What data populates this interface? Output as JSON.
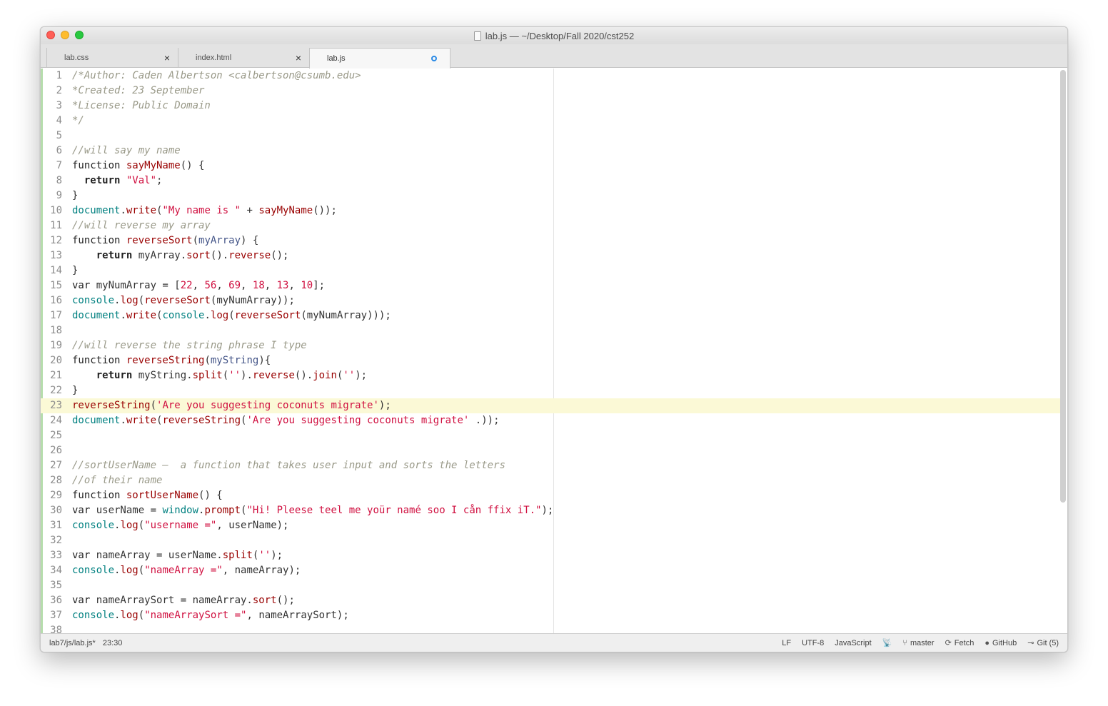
{
  "window": {
    "title": "lab.js — ~/Desktop/Fall 2020/cst252"
  },
  "tabs": [
    {
      "label": "lab.css",
      "close": "×"
    },
    {
      "label": "index.html",
      "close": "×"
    },
    {
      "label": "lab.js",
      "modified": true
    }
  ],
  "editor": {
    "current_line": 23,
    "lines": [
      {
        "n": "1",
        "tokens": [
          [
            "c",
            "/*Author: Caden Albertson <calbertson@csumb.edu>"
          ]
        ]
      },
      {
        "n": "2",
        "tokens": [
          [
            "c",
            "*Created: 23 September"
          ]
        ]
      },
      {
        "n": "3",
        "tokens": [
          [
            "c",
            "*License: Public Domain"
          ]
        ]
      },
      {
        "n": "4",
        "tokens": [
          [
            "c",
            "*/"
          ]
        ]
      },
      {
        "n": "5",
        "tokens": []
      },
      {
        "n": "6",
        "tokens": [
          [
            "c",
            "//will say my name"
          ]
        ]
      },
      {
        "n": "7",
        "tokens": [
          [
            "k",
            "function "
          ],
          [
            "f",
            "sayMyName"
          ],
          [
            "t",
            "() {"
          ]
        ]
      },
      {
        "n": "8",
        "tokens": [
          [
            "t",
            "  "
          ],
          [
            "kb",
            "return "
          ],
          [
            "s",
            "\"Val\""
          ],
          [
            "t",
            ";"
          ]
        ]
      },
      {
        "n": "9",
        "tokens": [
          [
            "t",
            "}"
          ]
        ]
      },
      {
        "n": "10",
        "tokens": [
          [
            "o",
            "document"
          ],
          [
            "t",
            "."
          ],
          [
            "f",
            "write"
          ],
          [
            "t",
            "("
          ],
          [
            "s",
            "\"My name is \""
          ],
          [
            "t",
            " + "
          ],
          [
            "f",
            "sayMyName"
          ],
          [
            "t",
            "());"
          ]
        ]
      },
      {
        "n": "11",
        "tokens": [
          [
            "c",
            "//will reverse my array"
          ]
        ]
      },
      {
        "n": "12",
        "tokens": [
          [
            "k",
            "function "
          ],
          [
            "f",
            "reverseSort"
          ],
          [
            "t",
            "("
          ],
          [
            "p",
            "myArray"
          ],
          [
            "t",
            ") {"
          ]
        ]
      },
      {
        "n": "13",
        "tokens": [
          [
            "t",
            "    "
          ],
          [
            "kb",
            "return "
          ],
          [
            "t",
            "myArray."
          ],
          [
            "f",
            "sort"
          ],
          [
            "t",
            "()."
          ],
          [
            "f",
            "reverse"
          ],
          [
            "t",
            "();"
          ]
        ]
      },
      {
        "n": "14",
        "tokens": [
          [
            "t",
            "}"
          ]
        ]
      },
      {
        "n": "15",
        "tokens": [
          [
            "k",
            "var "
          ],
          [
            "t",
            "myNumArray = ["
          ],
          [
            "n",
            "22"
          ],
          [
            "t",
            ", "
          ],
          [
            "n",
            "56"
          ],
          [
            "t",
            ", "
          ],
          [
            "n",
            "69"
          ],
          [
            "t",
            ", "
          ],
          [
            "n",
            "18"
          ],
          [
            "t",
            ", "
          ],
          [
            "n",
            "13"
          ],
          [
            "t",
            ", "
          ],
          [
            "n",
            "10"
          ],
          [
            "t",
            "];"
          ]
        ]
      },
      {
        "n": "16",
        "tokens": [
          [
            "o",
            "console"
          ],
          [
            "t",
            "."
          ],
          [
            "f",
            "log"
          ],
          [
            "t",
            "("
          ],
          [
            "f",
            "reverseSort"
          ],
          [
            "t",
            "(myNumArray));"
          ]
        ]
      },
      {
        "n": "17",
        "tokens": [
          [
            "o",
            "document"
          ],
          [
            "t",
            "."
          ],
          [
            "f",
            "write"
          ],
          [
            "t",
            "("
          ],
          [
            "o",
            "console"
          ],
          [
            "t",
            "."
          ],
          [
            "f",
            "log"
          ],
          [
            "t",
            "("
          ],
          [
            "f",
            "reverseSort"
          ],
          [
            "t",
            "(myNumArray)));"
          ]
        ]
      },
      {
        "n": "18",
        "tokens": []
      },
      {
        "n": "19",
        "tokens": [
          [
            "c",
            "//will reverse the string phrase I type"
          ]
        ]
      },
      {
        "n": "20",
        "tokens": [
          [
            "k",
            "function "
          ],
          [
            "f",
            "reverseString"
          ],
          [
            "t",
            "("
          ],
          [
            "p",
            "myString"
          ],
          [
            "t",
            "){"
          ]
        ]
      },
      {
        "n": "21",
        "tokens": [
          [
            "t",
            "    "
          ],
          [
            "kb",
            "return "
          ],
          [
            "t",
            "myString."
          ],
          [
            "f",
            "split"
          ],
          [
            "t",
            "("
          ],
          [
            "s",
            "''"
          ],
          [
            "t",
            ")."
          ],
          [
            "f",
            "reverse"
          ],
          [
            "t",
            "()."
          ],
          [
            "f",
            "join"
          ],
          [
            "t",
            "("
          ],
          [
            "s",
            "''"
          ],
          [
            "t",
            ");"
          ]
        ]
      },
      {
        "n": "22",
        "tokens": [
          [
            "t",
            "}"
          ]
        ]
      },
      {
        "n": "23",
        "tokens": [
          [
            "f",
            "reverseString"
          ],
          [
            "t",
            "("
          ],
          [
            "s",
            "'Are you suggesting coconuts migrate'"
          ],
          [
            "t",
            ");"
          ]
        ]
      },
      {
        "n": "24",
        "tokens": [
          [
            "o",
            "document"
          ],
          [
            "t",
            "."
          ],
          [
            "f",
            "write"
          ],
          [
            "t",
            "("
          ],
          [
            "f",
            "reverseString"
          ],
          [
            "t",
            "("
          ],
          [
            "s",
            "'Are you suggesting coconuts migrate'"
          ],
          [
            "t",
            " .));"
          ]
        ]
      },
      {
        "n": "25",
        "tokens": []
      },
      {
        "n": "26",
        "tokens": []
      },
      {
        "n": "27",
        "tokens": [
          [
            "c",
            "//sortUserName –  a function that takes user input and sorts the letters"
          ]
        ]
      },
      {
        "n": "28",
        "tokens": [
          [
            "c",
            "//of their name"
          ]
        ]
      },
      {
        "n": "29",
        "tokens": [
          [
            "k",
            "function "
          ],
          [
            "f",
            "sortUserName"
          ],
          [
            "t",
            "() {"
          ]
        ]
      },
      {
        "n": "30",
        "tokens": [
          [
            "k",
            "var "
          ],
          [
            "t",
            "userName = "
          ],
          [
            "o",
            "window"
          ],
          [
            "t",
            "."
          ],
          [
            "f",
            "prompt"
          ],
          [
            "t",
            "("
          ],
          [
            "s",
            "\"Hi! Pleese teel me yoür namé soo I cån ffix iT.\""
          ],
          [
            "t",
            ");"
          ]
        ]
      },
      {
        "n": "31",
        "tokens": [
          [
            "o",
            "console"
          ],
          [
            "t",
            "."
          ],
          [
            "f",
            "log"
          ],
          [
            "t",
            "("
          ],
          [
            "s",
            "\"username =\""
          ],
          [
            "t",
            ", userName);"
          ]
        ]
      },
      {
        "n": "32",
        "tokens": []
      },
      {
        "n": "33",
        "tokens": [
          [
            "k",
            "var "
          ],
          [
            "t",
            "nameArray = userName."
          ],
          [
            "f",
            "split"
          ],
          [
            "t",
            "("
          ],
          [
            "s",
            "''"
          ],
          [
            "t",
            ");"
          ]
        ]
      },
      {
        "n": "34",
        "tokens": [
          [
            "o",
            "console"
          ],
          [
            "t",
            "."
          ],
          [
            "f",
            "log"
          ],
          [
            "t",
            "("
          ],
          [
            "s",
            "\"nameArray =\""
          ],
          [
            "t",
            ", nameArray);"
          ]
        ]
      },
      {
        "n": "35",
        "tokens": []
      },
      {
        "n": "36",
        "tokens": [
          [
            "k",
            "var "
          ],
          [
            "t",
            "nameArraySort = nameArray."
          ],
          [
            "f",
            "sort"
          ],
          [
            "t",
            "();"
          ]
        ]
      },
      {
        "n": "37",
        "tokens": [
          [
            "o",
            "console"
          ],
          [
            "t",
            "."
          ],
          [
            "f",
            "log"
          ],
          [
            "t",
            "("
          ],
          [
            "s",
            "\"nameArraySort =\""
          ],
          [
            "t",
            ", nameArraySort);"
          ]
        ]
      },
      {
        "n": "38",
        "tokens": []
      }
    ]
  },
  "statusbar": {
    "file_path": "lab7/js/lab.js*",
    "cursor": "23:30",
    "line_ending": "LF",
    "encoding": "UTF-8",
    "grammar": "JavaScript",
    "branch": "master",
    "fetch": "Fetch",
    "github": "GitHub",
    "git": "Git (5)",
    "icons": {
      "teletype": "antenna-icon",
      "branch": "git-branch-icon",
      "fetch": "sync-icon",
      "github": "github-icon",
      "git": "git-commit-icon"
    }
  }
}
